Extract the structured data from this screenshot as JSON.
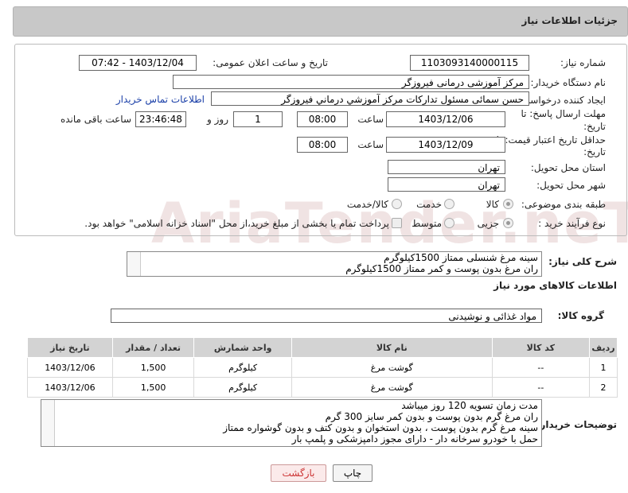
{
  "header": {
    "title": "جزئیات اطلاعات نیاز"
  },
  "form": {
    "need_number_label": "شماره نیاز:",
    "need_number": "1103093140000115",
    "announce_label": "تاریخ و ساعت اعلان عمومی:",
    "announce_value": "1403/12/04 - 07:42",
    "buyer_label": "نام دستگاه خریدار:",
    "buyer": "مرکز آموزشی درمانی فیروزگر",
    "creator_label": "ایجاد کننده درخواست:",
    "creator": "حسن سمائی مسئول تداركات مركز آموزشي درماني فيروزگر",
    "contact_link": "اطلاعات تماس خریدار",
    "deadline_label_1": "مهلت ارسال پاسخ: تا",
    "deadline_label_2": "تاریخ:",
    "deadline_date": "1403/12/06",
    "time_label": "ساعت",
    "deadline_time": "08:00",
    "days_value": "1",
    "days_label": "روز و",
    "remaining_time": "23:46:48",
    "remaining_label": "ساعت باقی مانده",
    "validity_label_1": "حداقل تاریخ اعتبار قیمت: تا",
    "validity_label_2": "تاریخ:",
    "validity_date": "1403/12/09",
    "validity_time": "08:00",
    "province_label": "استان محل تحویل:",
    "province": "تهران",
    "city_label": "شهر محل تحویل:",
    "city": "تهران",
    "category_label": "طبقه بندی موضوعی:",
    "category_options": [
      "کالا",
      "خدمت",
      "کالا/خدمت"
    ],
    "process_label": "نوع فرآیند خرید :",
    "process_options": [
      "جزیی",
      "متوسط"
    ],
    "payment_text": "پرداخت تمام یا بخشی از مبلغ خرید،از محل \"اسناد خزانه اسلامی\" خواهد بود."
  },
  "summary": {
    "label": "شرح کلی نیاز:",
    "lines": [
      "سینه مرغ شنسلی ممتاز 1500کیلوگرم",
      "ران مرغ بدون پوست و کمر ممتاز 1500کیلوگرم"
    ]
  },
  "goods": {
    "section_title": "اطلاعات کالاهای مورد نیاز",
    "group_label": "گروه کالا:",
    "group_value": "مواد غذائی و نوشیدنی",
    "columns": [
      "ردیف",
      "کد کالا",
      "نام کالا",
      "واحد شمارش",
      "تعداد / مقدار",
      "تاریخ نیاز"
    ],
    "rows": [
      [
        "1",
        "--",
        "گوشت مرغ",
        "کیلوگرم",
        "1,500",
        "1403/12/06"
      ],
      [
        "2",
        "--",
        "گوشت مرغ",
        "کیلوگرم",
        "1,500",
        "1403/12/06"
      ]
    ]
  },
  "buyer_notes": {
    "label": "توضیحات خریدار:",
    "lines": [
      "مدت زمان تسویه 120 روز میباشد",
      "ران مرغ گرم بدون پوست و بدون کمر سایز 300 گرم",
      "سینه مرغ گرم بدون پوست ، بدون استخوان و بدون کتف و بدون گوشواره ممتاز",
      "حمل با خودرو سرخانه دار - دارای مجوز دامپزشکی و پلمپ بار"
    ]
  },
  "buttons": {
    "print": "چاپ",
    "back": "بازگشت"
  },
  "watermark": "AriaTender.neT"
}
